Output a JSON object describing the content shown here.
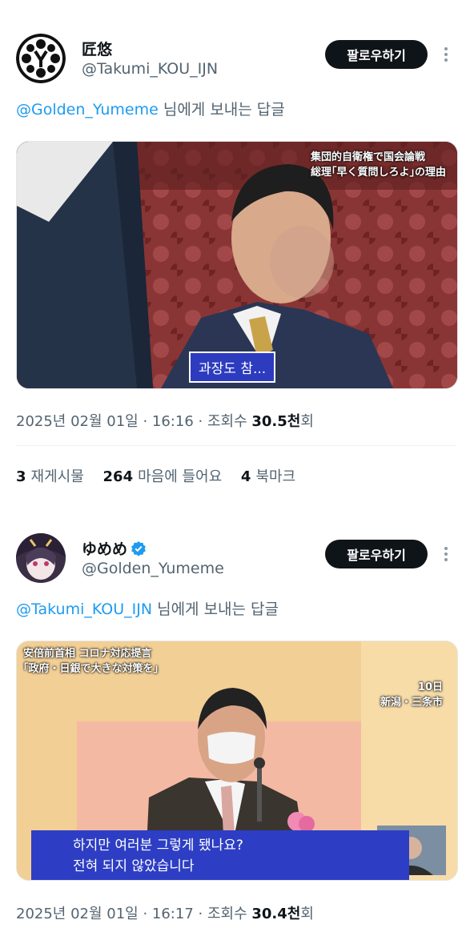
{
  "post1": {
    "display_name": "匠悠",
    "handle": "@Takumi_KOU_IJN",
    "follow_label": "팔로우하기",
    "reply_mention": "@Golden_Yumeme",
    "reply_suffix": " 님에게 보내는 답글",
    "image": {
      "caption_line1": "集団的自衛権で国会論戦",
      "caption_line2": "総理｢早く質問しろよ｣の理由",
      "subtitle": "과장도 참..."
    },
    "date": "2025년 02월 01일 · 16:16 · 조회수 ",
    "views": "30.5천",
    "views_suffix": "회",
    "stats": {
      "reposts_count": "3",
      "reposts_label": "재게시물",
      "likes_count": "264",
      "likes_label": "마음에 들어요",
      "bookmarks_count": "4",
      "bookmarks_label": "북마크"
    }
  },
  "post2": {
    "display_name": "ゆめめ",
    "handle": "@Golden_Yumeme",
    "follow_label": "팔로우하기",
    "reply_mention": "@Takumi_KOU_IJN",
    "reply_suffix": " 님에게 보내는 답글",
    "image": {
      "caption_top_line1": "安倍前首相 コロナ対応提言",
      "caption_top_line2": "｢政府・日銀で大きな対策を｣",
      "caption_date": "10日",
      "caption_place": "新潟・三条市",
      "subtitle_line1": "하지만 여러분 그렇게 됐나요?",
      "subtitle_line2": "전혀 되지 않았습니다"
    },
    "date": "2025년 02월 01일 · 16:17 · 조회수 ",
    "views": "30.4천",
    "views_suffix": "회"
  },
  "colors": {
    "accent": "#1d9bf0",
    "text_primary": "#0f1419",
    "text_secondary": "#536471",
    "button_bg": "#0f1419"
  },
  "icons": [
    "more-options-icon",
    "verified-badge-icon"
  ]
}
